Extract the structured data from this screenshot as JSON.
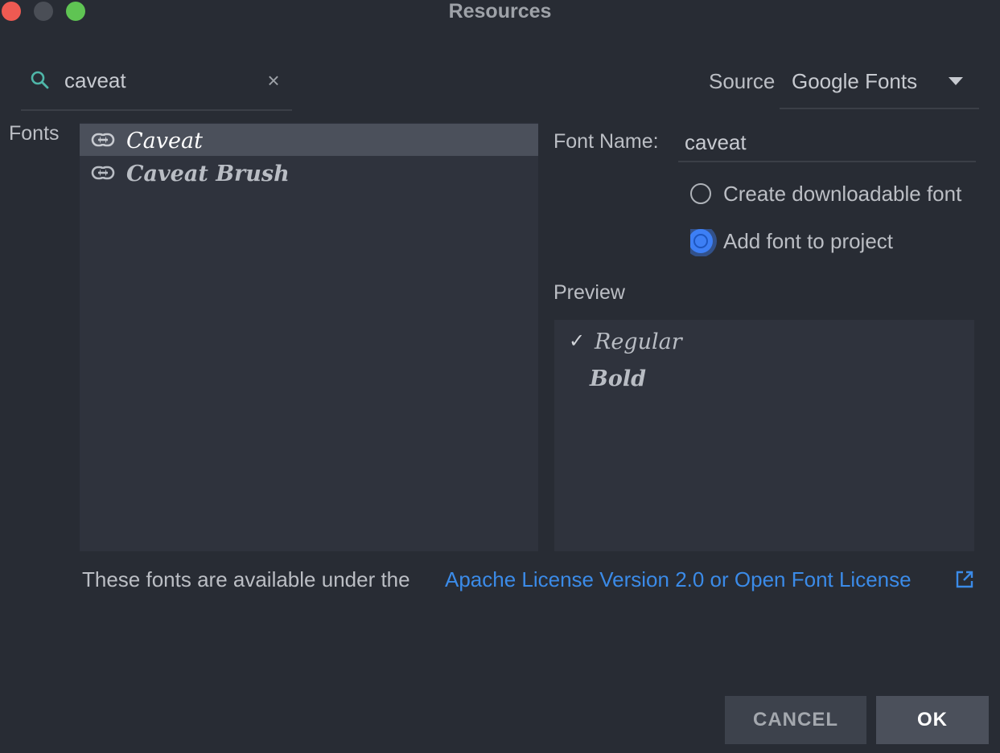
{
  "window": {
    "title": "Resources"
  },
  "search": {
    "value": "caveat",
    "clear_symbol": "×"
  },
  "source": {
    "label": "Source",
    "selected": "Google Fonts"
  },
  "fonts_panel": {
    "label": "Fonts",
    "items": [
      {
        "name": "Caveat",
        "selected": true
      },
      {
        "name": "Caveat Brush",
        "selected": false
      }
    ]
  },
  "details": {
    "font_name_label": "Font Name:",
    "font_name_value": "caveat",
    "options": [
      {
        "label": "Create downloadable font",
        "checked": false
      },
      {
        "label": "Add font to project",
        "checked": true
      }
    ],
    "preview_label": "Preview",
    "preview_items": [
      {
        "check": "✓",
        "label": "Regular"
      },
      {
        "label": "Bold"
      }
    ]
  },
  "license": {
    "text": "These fonts are available under the",
    "link": "Apache License Version 2.0 or Open Font License"
  },
  "buttons": {
    "cancel": "CANCEL",
    "ok": "OK"
  },
  "colors": {
    "background": "#282c34",
    "panel": "#2f333d",
    "selection": "#4b505b",
    "accent": "#3d7ff5",
    "link": "#3b8be8",
    "close": "#ee5a52",
    "maximize": "#5fc453"
  },
  "icons": {
    "search": "search-icon",
    "font_item": "link-icon",
    "external": "external-link-icon"
  }
}
